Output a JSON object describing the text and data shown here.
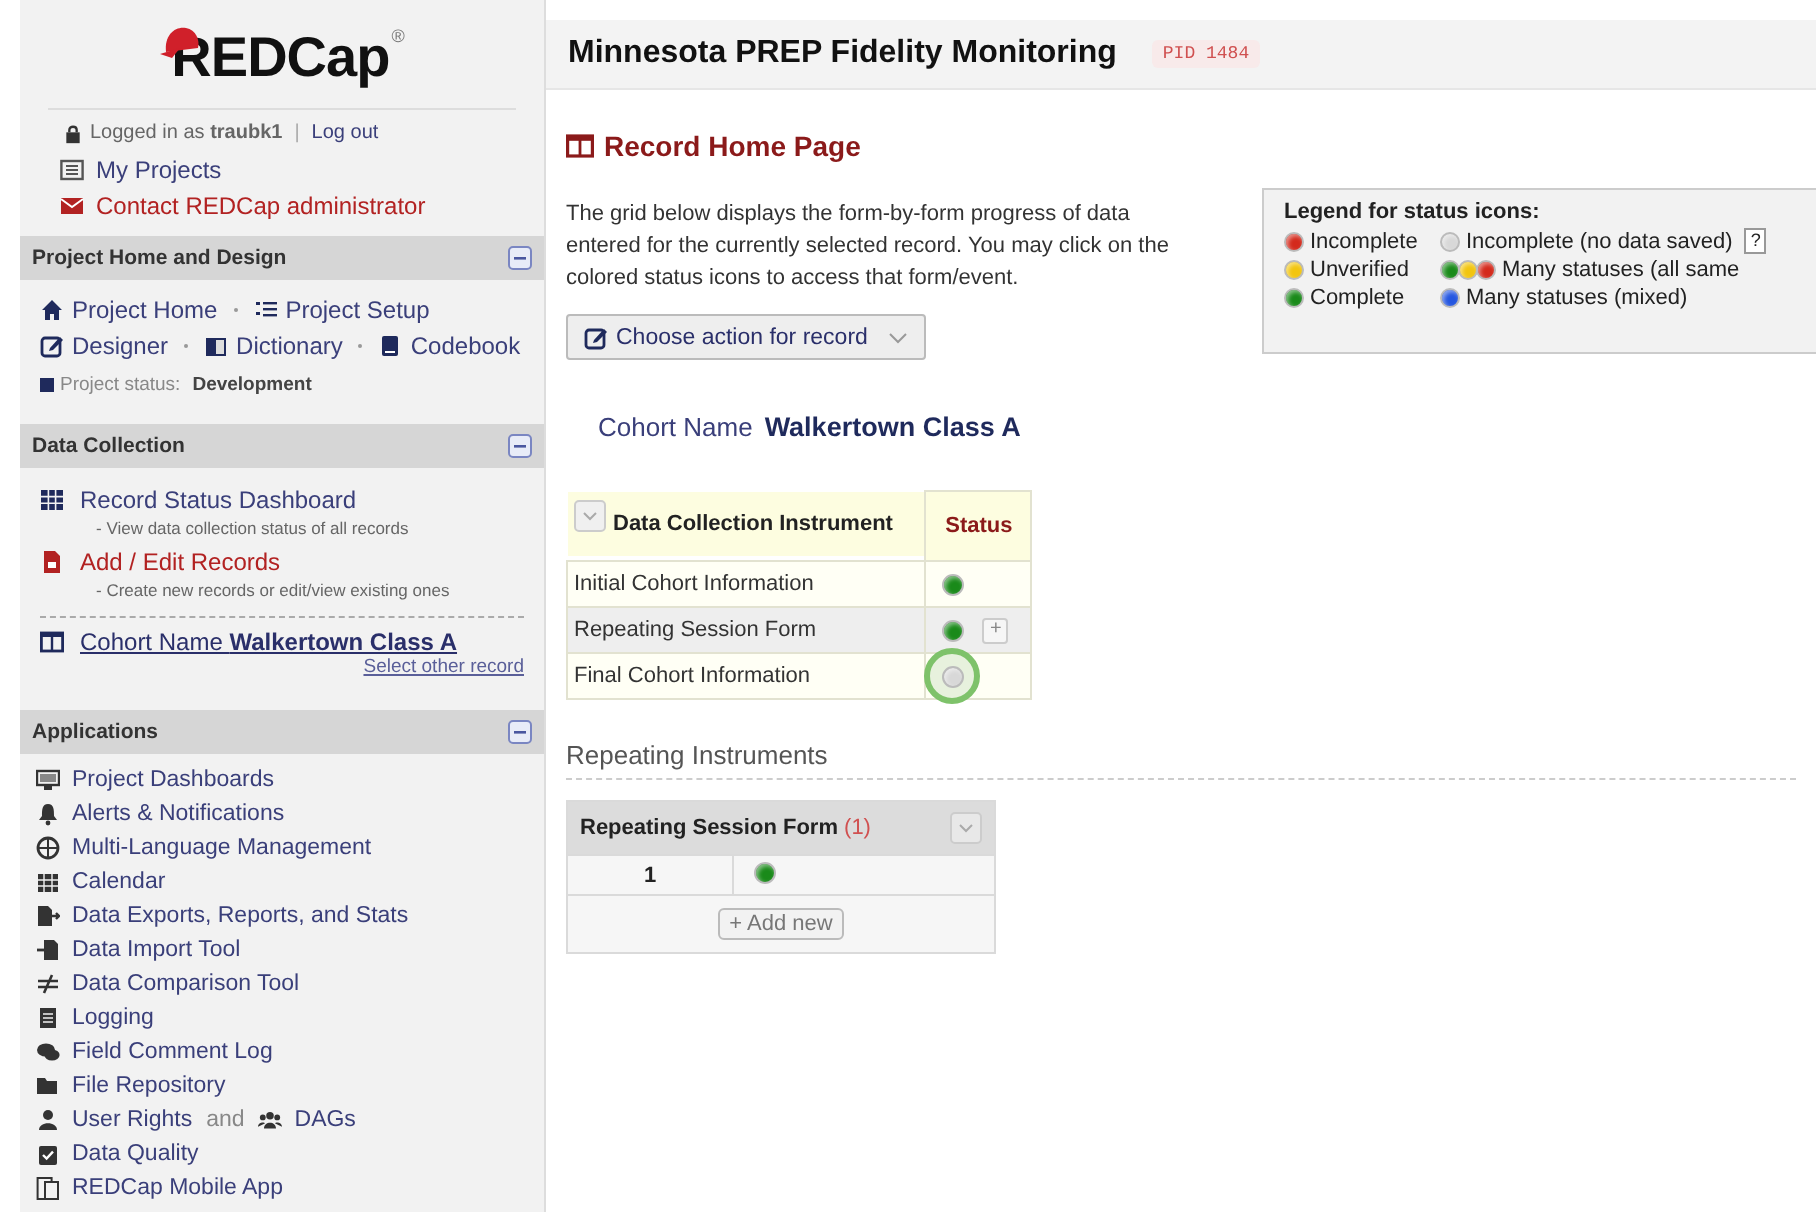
{
  "logo": {
    "text": "REDCap",
    "mark": "®"
  },
  "login": {
    "prefix": "Logged in as",
    "user": "traubk1",
    "separator": "|",
    "logout": "Log out"
  },
  "top_links": [
    {
      "label": "My Projects",
      "kind": "normal"
    },
    {
      "label": "Contact REDCap administrator",
      "kind": "alert"
    }
  ],
  "project_design": {
    "title": "Project Home and Design",
    "link_lines": [
      {
        "links": [
          "Project Home",
          "Project Setup"
        ]
      },
      {
        "links": [
          "Designer",
          "Dictionary",
          "Codebook"
        ]
      }
    ],
    "status_label": "Project status:",
    "status_value": "Development"
  },
  "data_collection": {
    "title": "Data Collection",
    "items": [
      {
        "label": "Record Status Dashboard",
        "note": "- View data collection status of all records",
        "kind": "normal"
      },
      {
        "label": "Add / Edit Records",
        "note": "- Create new records or edit/view existing ones",
        "kind": "alert"
      }
    ],
    "record_field": "Cohort Name",
    "record_value": "Walkertown Class A",
    "select_other": "Select other record"
  },
  "applications": {
    "title": "Applications",
    "items": [
      {
        "label": "Project Dashboards"
      },
      {
        "label": "Alerts & Notifications"
      },
      {
        "label": "Multi-Language Management"
      },
      {
        "label": "Calendar"
      },
      {
        "label": "Data Exports, Reports, and Stats"
      },
      {
        "label": "Data Import Tool"
      },
      {
        "label": "Data Comparison Tool"
      },
      {
        "label": "Logging"
      },
      {
        "label": "Field Comment Log"
      },
      {
        "label": "File Repository"
      },
      {
        "label": "User Rights",
        "joiner": "and",
        "extra": "DAGs"
      },
      {
        "label": "Data Quality"
      },
      {
        "label": "REDCap Mobile App"
      }
    ]
  },
  "project": {
    "title": "Minnesota PREP Fidelity Monitoring",
    "pid": "PID 1484"
  },
  "page_title": "Record Home Page",
  "intro": "The grid below displays the form-by-form progress of data entered for the currently selected record. You may click on the colored status icons to access that form/event.",
  "action_button": "Choose action for record",
  "legend": {
    "title": "Legend for status icons:",
    "items": [
      {
        "label": "Incomplete",
        "kind": "single",
        "color": "#d42a1c"
      },
      {
        "label": "Incomplete (no data saved)",
        "kind": "single",
        "color": "#d8d8d8",
        "help": "?"
      },
      {
        "label": "Unverified",
        "kind": "single",
        "color": "#f2c50f"
      },
      {
        "label": "Many statuses (all same",
        "kind": "stack"
      },
      {
        "label": "Complete",
        "kind": "single",
        "color": "#1a8a1a"
      },
      {
        "label": "Many statuses (mixed)",
        "kind": "single",
        "color": "#2456e0"
      }
    ]
  },
  "record": {
    "field": "Cohort Name",
    "value": "Walkertown Class A"
  },
  "instruments": {
    "columns": [
      "Data Collection Instrument",
      "Status"
    ],
    "rows": [
      {
        "name": "Initial Cohort Information",
        "color": "#1a8a1a",
        "highlighted": false
      },
      {
        "name": "Repeating Session Form",
        "color": "#1a8a1a",
        "highlighted": false,
        "add_button": "+"
      },
      {
        "name": "Final Cohort Information",
        "color": "#d8d8d8",
        "highlighted": true
      }
    ]
  },
  "repeating": {
    "heading": "Repeating Instruments",
    "form": "Repeating Session Form",
    "count": "(1)",
    "rows": [
      {
        "number": "1",
        "color": "#1a8a1a"
      }
    ],
    "add_button": "+ Add new"
  }
}
